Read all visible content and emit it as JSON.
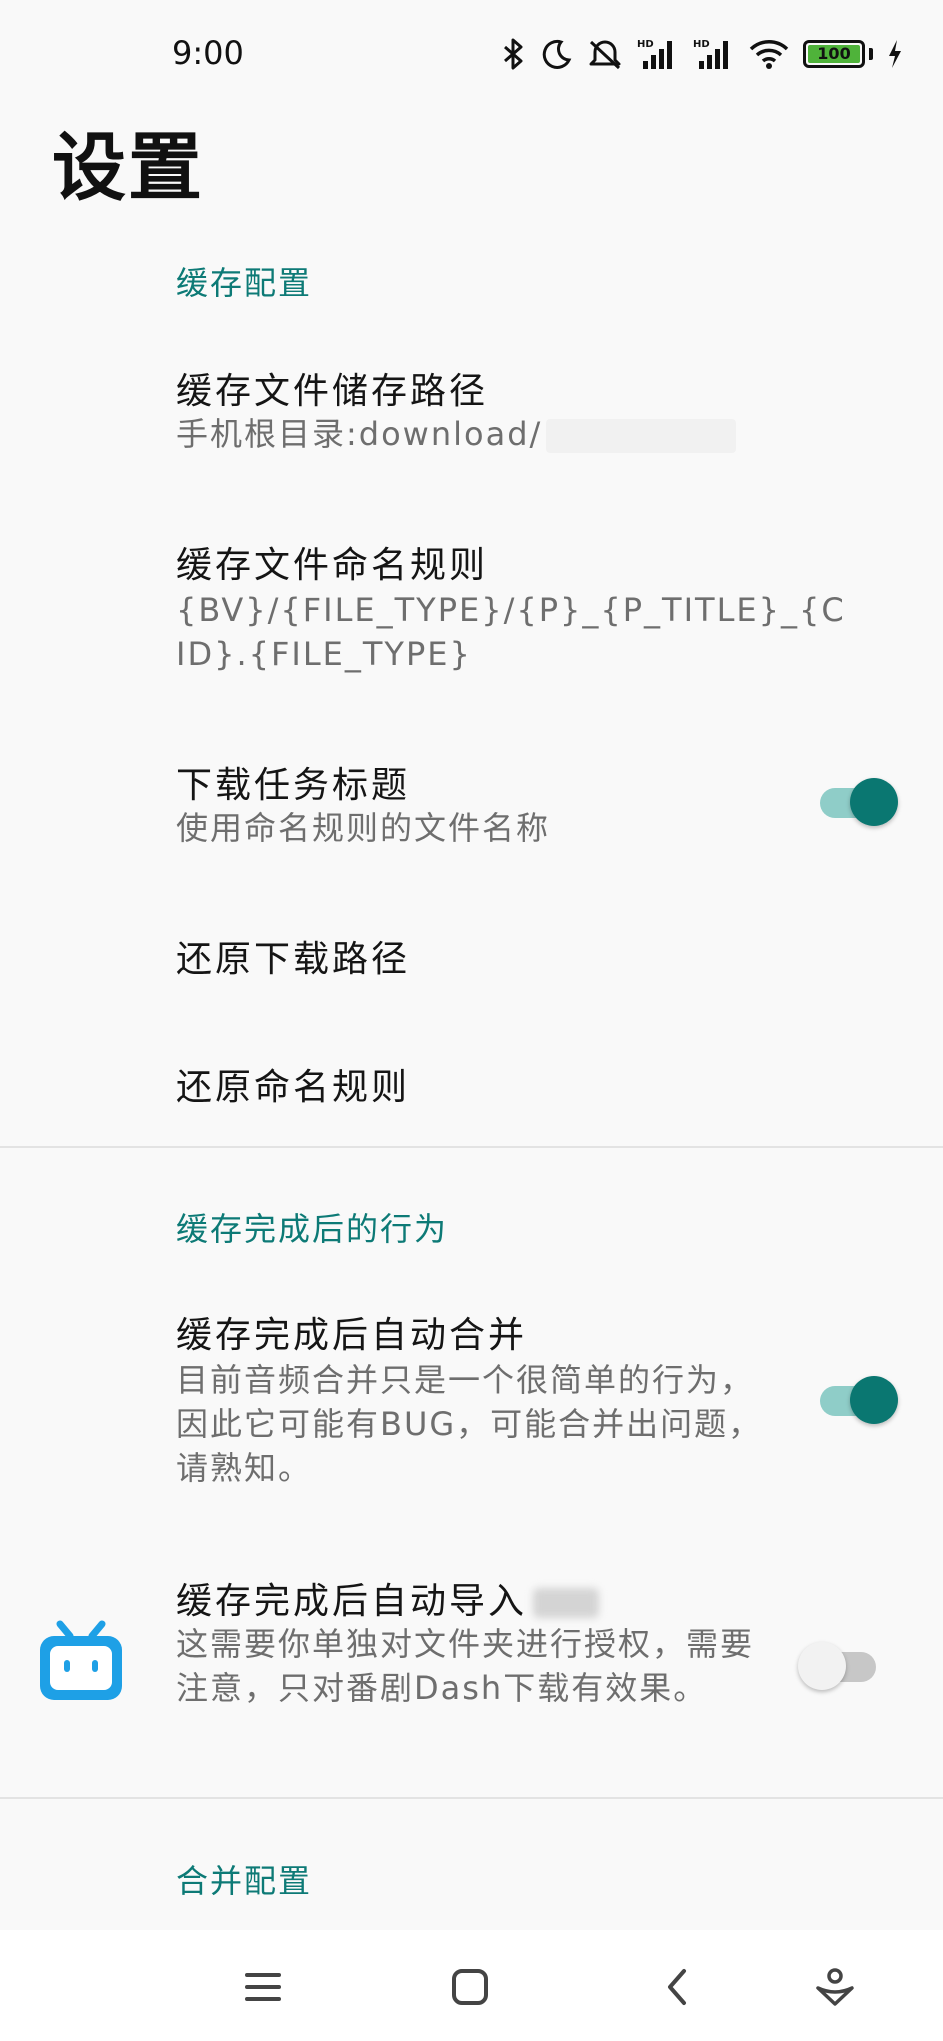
{
  "status_bar": {
    "time": "9:00",
    "battery_level": "100",
    "icons": [
      "bluetooth-icon",
      "moon-icon",
      "mute-icon",
      "signal-hd-icon",
      "signal-hd-icon",
      "wifi-icon",
      "battery-icon",
      "charging-icon"
    ]
  },
  "page": {
    "title": "设置"
  },
  "sections": {
    "cache_config": {
      "header": "缓存配置",
      "storage_path": {
        "title": "缓存文件储存路径",
        "subtitle": "手机根目录:download/"
      },
      "naming_rule": {
        "title": "缓存文件命名规则",
        "subtitle": "{BV}/{FILE_TYPE}/{P}_{P_TITLE}_{CID}.{FILE_TYPE}"
      },
      "task_title": {
        "title": "下载任务标题",
        "subtitle": "使用命名规则的文件名称",
        "enabled": true
      },
      "restore_path": {
        "title": "还原下载路径"
      },
      "restore_naming": {
        "title": "还原命名规则"
      }
    },
    "after_cache": {
      "header": "缓存完成后的行为",
      "auto_merge": {
        "title": "缓存完成后自动合并",
        "subtitle": "目前音频合并只是一个很简单的行为，因此它可能有BUG，可能合并出问题，请熟知。",
        "enabled": true
      },
      "auto_import": {
        "title": "缓存完成后自动导入",
        "subtitle": "这需要你单独对文件夹进行授权，需要注意，只对番剧Dash下载有效果。",
        "enabled": false
      }
    },
    "merge_config": {
      "header": "合并配置"
    }
  },
  "floating_icon": "bilibili-tv-icon",
  "nav_bar": {
    "icons": [
      "menu-icon",
      "home-icon",
      "back-icon",
      "assistant-icon"
    ]
  },
  "colors": {
    "accent": "#0d7a76",
    "switch_on_thumb": "#0a7771",
    "switch_on_track": "#8fcdc8",
    "app_icon_blue": "#1ea0e6"
  }
}
